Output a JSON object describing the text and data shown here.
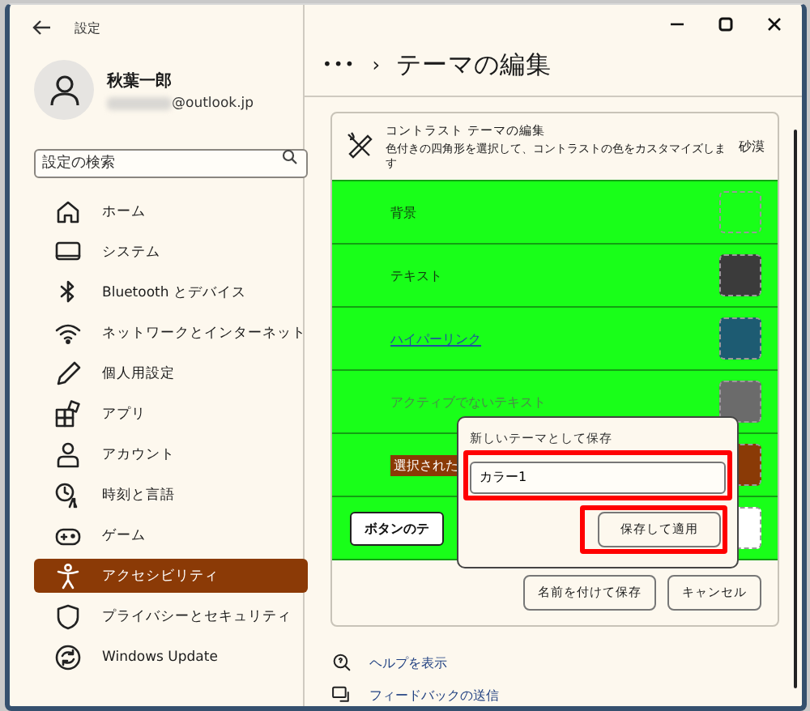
{
  "window": {
    "title": "設定"
  },
  "account": {
    "name": "秋葉一郎",
    "email": "@outlook.jp"
  },
  "search": {
    "placeholder": "設定の検索"
  },
  "sidebar": {
    "items": [
      {
        "label": "ホーム",
        "selected": false
      },
      {
        "label": "システム",
        "selected": false
      },
      {
        "label": "Bluetooth とデバイス",
        "selected": false
      },
      {
        "label": "ネットワークとインターネット",
        "selected": false
      },
      {
        "label": "個人用設定",
        "selected": false
      },
      {
        "label": "アプリ",
        "selected": false
      },
      {
        "label": "アカウント",
        "selected": false
      },
      {
        "label": "時刻と言語",
        "selected": false
      },
      {
        "label": "ゲーム",
        "selected": false
      },
      {
        "label": "アクセシビリティ",
        "selected": true
      },
      {
        "label": "プライバシーとセキュリティ",
        "selected": false
      },
      {
        "label": "Windows Update",
        "selected": false
      }
    ]
  },
  "breadcrumb": {
    "more": "•••",
    "separator": "›",
    "title": "テーマの編集"
  },
  "editor": {
    "title": "コントラスト テーマの編集",
    "description": "色付きの四角形を選択して、コントラストの色をカスタマイズします",
    "theme": "砂漠",
    "rows": [
      {
        "kind": "plain",
        "label": "背景",
        "color": "#19ff19"
      },
      {
        "kind": "plain",
        "label": "テキスト",
        "color": "#3b3b3b"
      },
      {
        "kind": "link",
        "label": "ハイパーリンク",
        "color": "#1d5b72"
      },
      {
        "kind": "inactive",
        "label": "アクティブでないテキスト",
        "color": "#6b6b6b"
      },
      {
        "kind": "selected",
        "label": "選択された",
        "color": "#8a3a06"
      },
      {
        "kind": "button",
        "label": "ボタンのテ",
        "color": "#ffffff"
      }
    ],
    "buttons": [
      "名前を付けて保存",
      "キャンセル"
    ]
  },
  "popup": {
    "title": "新しいテーマとして保存",
    "value": "カラー1",
    "button": "保存して適用",
    "field_highlight": true,
    "button_highlight": true
  },
  "links": [
    {
      "label": "ヘルプを表示"
    },
    {
      "label": "フィードバックの送信"
    }
  ]
}
